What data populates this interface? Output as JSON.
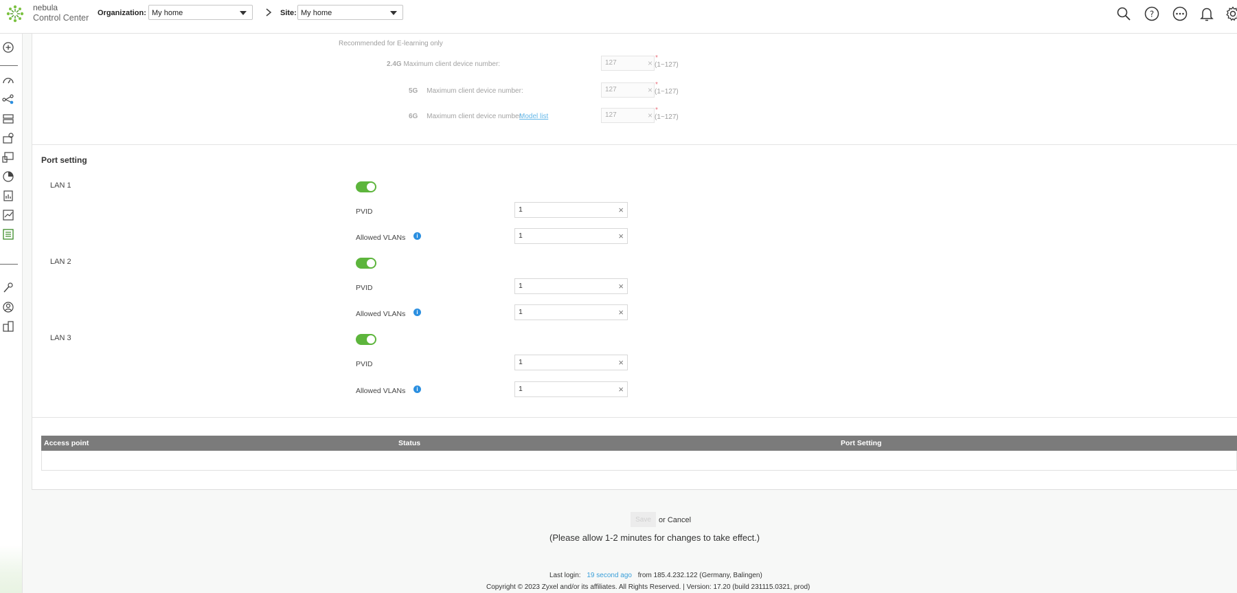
{
  "header": {
    "brand_line1": "nebula",
    "brand_line2": "Control Center",
    "org_label": "Organization:",
    "org_value": "My home",
    "site_label": "Site:",
    "site_value": "My home",
    "icons": [
      "search-icon",
      "help-icon",
      "more-icon",
      "bell-icon",
      "gear-icon"
    ]
  },
  "sidebar": {
    "icons": [
      "add-site-icon",
      "dashboard-icon",
      "topology-icon",
      "devices-icon",
      "access-point-icon",
      "clients-icon",
      "monitor-pie-icon",
      "report-icon",
      "analytics-icon",
      "configure-icon",
      "site-tools-icon",
      "support-icon",
      "organization-icon"
    ]
  },
  "wifi_limits": {
    "note": "Recommended for E-learning only",
    "rows": [
      {
        "band": "2.4G",
        "label": "Maximum client device number:",
        "value": "127",
        "required": "*",
        "range": "(1~127)"
      },
      {
        "band": "5G",
        "label": "Maximum client device number:",
        "value": "127",
        "required": "*",
        "range": "(1~127)"
      },
      {
        "band": "6G",
        "label": "Maximum client device number:",
        "value": "127",
        "required": "*",
        "range": "(1~127)",
        "link": "Model list"
      }
    ]
  },
  "port_setting": {
    "title": "Port setting",
    "pvid_label": "PVID",
    "vlans_label": "Allowed VLANs",
    "ports": [
      {
        "name": "LAN 1",
        "enabled": true,
        "pvid": "1",
        "allowed_vlans": "1"
      },
      {
        "name": "LAN 2",
        "enabled": true,
        "pvid": "1",
        "allowed_vlans": "1"
      },
      {
        "name": "LAN 3",
        "enabled": true,
        "pvid": "1",
        "allowed_vlans": "1"
      }
    ]
  },
  "table": {
    "columns": [
      "Access point",
      "Status",
      "Port Setting"
    ],
    "rows": []
  },
  "footer": {
    "save_label": "Save",
    "or_cancel": "or Cancel",
    "notice": "(Please allow 1-2 minutes for changes to take effect.)",
    "last_login_prefix": "Last login:",
    "last_login_ago": "19 second ago",
    "last_login_from": "from 185.4.232.122 (Germany, Balingen)",
    "copyright": "Copyright © 2023 Zyxel and/or its affiliates. All Rights Reserved. | Version: 17.20 (build 231115.0321, prod)"
  },
  "colors": {
    "brand_green": "#5db53c",
    "info_blue": "#2b8fe0",
    "link_blue": "#3a9fd9",
    "table_header": "#7b7b7b"
  }
}
